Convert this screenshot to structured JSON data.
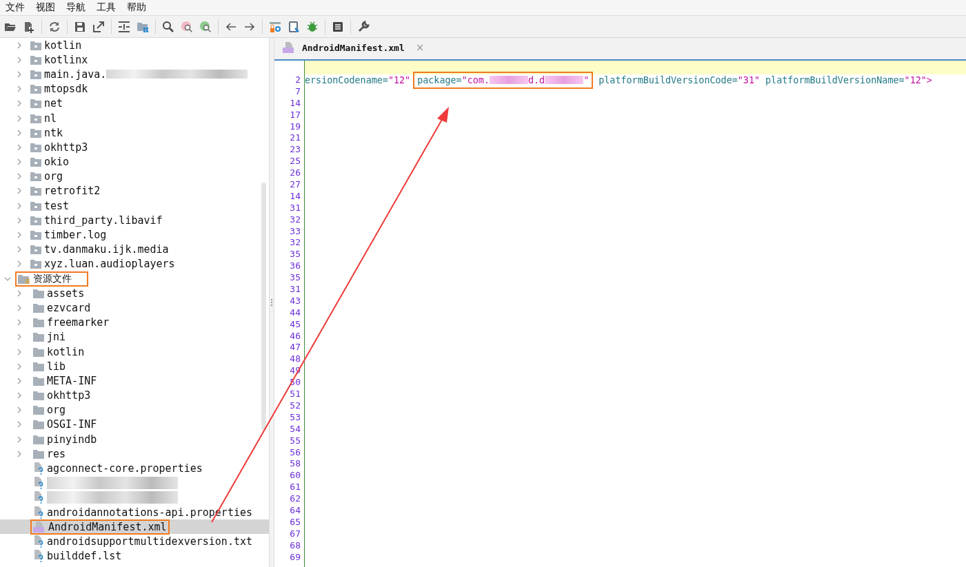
{
  "menu": [
    "文件",
    "视图",
    "导航",
    "工具",
    "帮助"
  ],
  "sources": [
    {
      "label": "kotlin",
      "kind": "folder",
      "redacted": false
    },
    {
      "label": "kotlinx",
      "kind": "folder",
      "redacted": false
    },
    {
      "label": "main.java.",
      "kind": "folder",
      "redacted": true
    },
    {
      "label": "mtopsdk",
      "kind": "folder",
      "redacted": false
    },
    {
      "label": "net",
      "kind": "folder",
      "redacted": false
    },
    {
      "label": "nl",
      "kind": "folder",
      "redacted": false
    },
    {
      "label": "ntk",
      "kind": "folder",
      "redacted": false
    },
    {
      "label": "okhttp3",
      "kind": "folder",
      "redacted": false
    },
    {
      "label": "okio",
      "kind": "folder",
      "redacted": false
    },
    {
      "label": "org",
      "kind": "folder",
      "redacted": false
    },
    {
      "label": "retrofit2",
      "kind": "folder",
      "redacted": false
    },
    {
      "label": "test",
      "kind": "folder",
      "redacted": false
    },
    {
      "label": "third_party.libavif",
      "kind": "folder",
      "redacted": false
    },
    {
      "label": "timber.log",
      "kind": "folder",
      "redacted": false
    },
    {
      "label": "tv.danmaku.ijk.media",
      "kind": "folder",
      "redacted": false
    },
    {
      "label": "xyz.luan.audioplayers",
      "kind": "folder",
      "redacted": false
    }
  ],
  "resources": {
    "label": "资源文件",
    "expanded": true,
    "annotated": true,
    "children": [
      {
        "label": "assets",
        "kind": "folder",
        "selected": false,
        "annotated": false
      },
      {
        "label": "ezvcard",
        "kind": "folder",
        "selected": false,
        "annotated": false
      },
      {
        "label": "freemarker",
        "kind": "folder",
        "selected": false,
        "annotated": false
      },
      {
        "label": "jni",
        "kind": "folder",
        "selected": false,
        "annotated": false
      },
      {
        "label": "kotlin",
        "kind": "folder",
        "selected": false,
        "annotated": false
      },
      {
        "label": "lib",
        "kind": "folder",
        "selected": false,
        "annotated": false
      },
      {
        "label": "META-INF",
        "kind": "folder",
        "selected": false,
        "annotated": false
      },
      {
        "label": "okhttp3",
        "kind": "folder",
        "selected": false,
        "annotated": false
      },
      {
        "label": "org",
        "kind": "folder",
        "selected": false,
        "annotated": false
      },
      {
        "label": "OSGI-INF",
        "kind": "folder",
        "selected": false,
        "annotated": false
      },
      {
        "label": "pinyindb",
        "kind": "folder",
        "selected": false,
        "annotated": false
      },
      {
        "label": "res",
        "kind": "folder",
        "selected": false,
        "annotated": false
      },
      {
        "label": "agconnect-core.properties",
        "kind": "file",
        "selected": false,
        "annotated": false
      },
      {
        "kind": "redacted",
        "selected": false,
        "annotated": false
      },
      {
        "kind": "redacted",
        "selected": false,
        "annotated": false
      },
      {
        "label": "androidannotations-api.properties",
        "kind": "file",
        "selected": false,
        "annotated": false
      },
      {
        "label": "AndroidManifest.xml",
        "kind": "manifest",
        "selected": true,
        "annotated": true
      },
      {
        "label": "androidsupportmultidexversion.txt",
        "kind": "file",
        "selected": false,
        "annotated": false
      },
      {
        "label": "builddef.lst",
        "kind": "file",
        "selected": false,
        "annotated": false
      }
    ]
  },
  "editor_tab": {
    "label": "AndroidManifest.xml",
    "close": "×"
  },
  "line_numbers": [
    "2",
    "7",
    "14",
    "17",
    "19",
    "21",
    "23",
    "25",
    "26",
    "27",
    "14",
    "31",
    "32",
    "33",
    "32",
    "35",
    "36",
    "35",
    "31",
    "43",
    "44",
    "45",
    "46",
    "47",
    "48",
    "49",
    "50",
    "51",
    "52",
    "53",
    "54",
    "55",
    "56",
    "58",
    "60",
    "61",
    "62",
    "64",
    "65",
    "67",
    "68",
    "69"
  ],
  "code_line": [
    {
      "kind": "attr",
      "text": "ersionCodename="
    },
    {
      "kind": "value",
      "text": "\"12\""
    },
    {
      "kind": "group",
      "annotated": true,
      "parts": [
        {
          "kind": "attr",
          "text": "package="
        },
        {
          "kind": "value",
          "text": "\"com."
        },
        {
          "kind": "redacted"
        },
        {
          "kind": "value",
          "text": "d.d"
        },
        {
          "kind": "redacted"
        },
        {
          "kind": "value",
          "text": "\""
        }
      ]
    },
    {
      "kind": "attr",
      "text": "platformBuildVersionCode="
    },
    {
      "kind": "value",
      "text": "\"31\""
    },
    {
      "kind": "attr",
      "text": "platformBuildVersionName="
    },
    {
      "kind": "value",
      "text": "\"12\">"
    }
  ]
}
